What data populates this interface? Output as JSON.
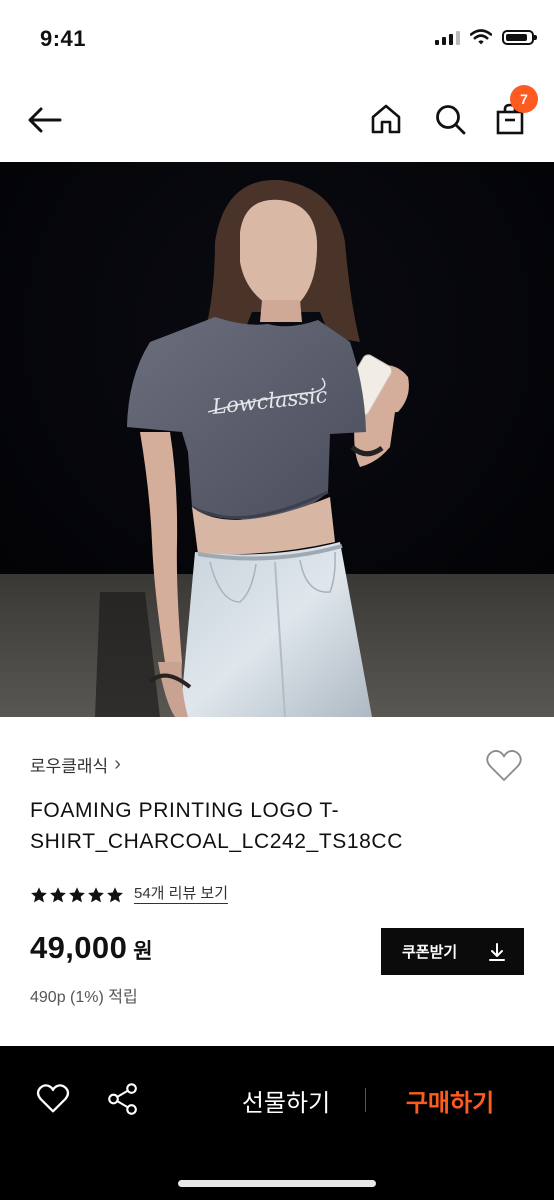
{
  "status": {
    "time": "9:41"
  },
  "header": {
    "cart_count": "7"
  },
  "product": {
    "image_shirt_text": "Lowclassic",
    "brand": "로우클래식",
    "brand_chevron": "›",
    "title": "FOAMING PRINTING LOGO T-SHIRT_CHARCOAL_LC242_TS18CC",
    "rating": 5,
    "review_link": "54개 리뷰 보기",
    "price": "49,000",
    "price_unit": "원",
    "points": "490p (1%) 적립",
    "coupon_label": "쿠폰받기"
  },
  "bottom_bar": {
    "gift_label": "선물하기",
    "buy_label": "구매하기"
  },
  "colors": {
    "accent": "#ff5a1f",
    "bottom_bar_bg": "#000000",
    "coupon_bg": "#0b0b0b"
  },
  "icons": [
    "back-arrow-icon",
    "home-icon",
    "search-icon",
    "shopping-bag-icon",
    "heart-icon",
    "star-icon",
    "download-icon",
    "share-icon"
  ]
}
